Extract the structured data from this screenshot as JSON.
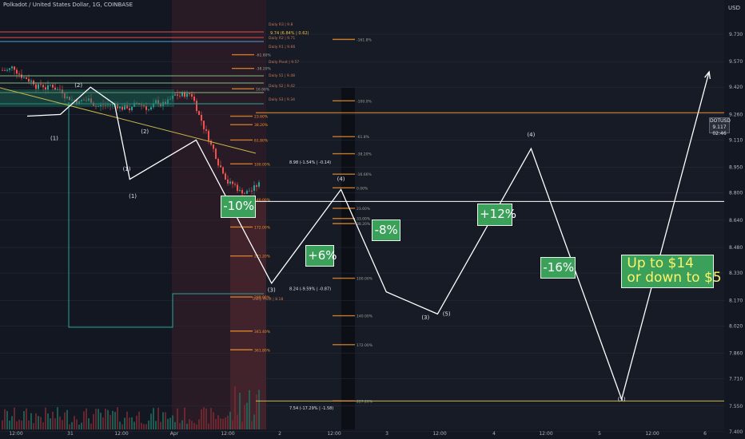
{
  "header": {
    "title": "Polkadot / United States Dollar, 1G, COINBASE",
    "currency": "USD"
  },
  "price_tag": {
    "symbol": "DOTUSD",
    "price": "9.117",
    "timer": "02:46"
  },
  "chart_data": {
    "type": "line",
    "y_axis": {
      "range": [
        7.46,
        9.8
      ],
      "ticks": [
        7.4,
        7.55,
        7.71,
        7.86,
        8.02,
        8.17,
        8.33,
        8.48,
        8.64,
        8.8,
        8.95,
        9.11,
        9.26,
        9.42,
        9.57,
        9.73
      ]
    },
    "x_axis": {
      "labels": [
        "12:00",
        "31",
        "12:00",
        "Apr",
        "12:00",
        "2",
        "12:00",
        "3",
        "12:00",
        "4",
        "12:00",
        "5",
        "12:00",
        "6"
      ]
    },
    "series": [
      {
        "values": [
          [
            9.25,
            7.49
          ],
          [
            9.26,
            7.6
          ],
          [
            9.42,
            7.7
          ],
          [
            9.32,
            7.78
          ],
          [
            8.88,
            7.83
          ],
          [
            9.11,
            8.05
          ],
          [
            8.27,
            8.3
          ],
          [
            8.82,
            8.53
          ],
          [
            8.22,
            8.68
          ],
          [
            8.09,
            8.85
          ],
          [
            9.06,
            9.16
          ],
          [
            7.59,
            9.46
          ],
          [
            9.51,
            9.75
          ]
        ]
      }
    ],
    "wave_labels": [
      {
        "text": "(2)",
        "x": 9.42,
        "y": 7.66
      },
      {
        "text": "(1)",
        "x": 9.11,
        "y": 7.58
      },
      {
        "text": "(1)",
        "x": 8.93,
        "y": 7.82
      },
      {
        "text": "(2)",
        "x": 9.15,
        "y": 7.88
      },
      {
        "text": "(1)",
        "x": 8.77,
        "y": 7.84
      },
      {
        "text": "(3)",
        "x": 8.22,
        "y": 8.3
      },
      {
        "text": "(4)",
        "x": 8.87,
        "y": 8.53
      },
      {
        "text": "(3)",
        "x": 8.06,
        "y": 8.81
      },
      {
        "text": "(5)",
        "x": 8.08,
        "y": 8.88
      },
      {
        "text": "(4)",
        "x": 9.13,
        "y": 9.16
      },
      {
        "text": "(5)",
        "x": 7.58,
        "y": 9.46
      }
    ],
    "callouts": [
      {
        "text": "-10%",
        "x": 8.72,
        "y": 8.19,
        "style": "green"
      },
      {
        "text": "+6%",
        "x": 8.43,
        "y": 8.46,
        "style": "green"
      },
      {
        "text": "-8%",
        "x": 8.58,
        "y": 8.68,
        "style": "green"
      },
      {
        "text": "+12%",
        "x": 8.67,
        "y": 9.04,
        "style": "green"
      },
      {
        "text": "-16%",
        "x": 8.36,
        "y": 9.25,
        "style": "green"
      },
      {
        "text": "Up to $14",
        "x": 8.39,
        "y": 9.47,
        "style": "yellow"
      },
      {
        "text": "or down to $5",
        "x": 8.26,
        "y": 9.47,
        "style": "yellow"
      }
    ],
    "fib_levels": [
      {
        "label": "-161.8%",
        "y": 9.7
      },
      {
        "label": "-100.0%",
        "y": 9.34
      },
      {
        "label": "-61.8%",
        "y": 9.13
      },
      {
        "label": "-38.20%",
        "y": 9.03
      },
      {
        "label": "-16.66%",
        "y": 8.91
      },
      {
        "label": "0.00%",
        "y": 8.83
      },
      {
        "label": "23.60%",
        "y": 8.71
      },
      {
        "label": "33.00%",
        "y": 8.65
      },
      {
        "label": "38.20%",
        "y": 8.62
      },
      {
        "label": "100.00%",
        "y": 8.3
      },
      {
        "label": "140.00%",
        "y": 8.08
      },
      {
        "label": "172.00%",
        "y": 7.91
      },
      {
        "label": "227.20%",
        "y": 7.58
      },
      {
        "label": "23.60%",
        "y": 9.25
      },
      {
        "label": "38.20%",
        "y": 9.2
      },
      {
        "label": "61.80%",
        "y": 9.11
      },
      {
        "label": "100.00%",
        "y": 8.97
      },
      {
        "label": "140.00%",
        "y": 8.76
      },
      {
        "label": "172.00%",
        "y": 8.6
      },
      {
        "label": "221.20%",
        "y": 8.43
      },
      {
        "label": "289.00%",
        "y": 8.19
      },
      {
        "label": "341.40%",
        "y": 7.99
      },
      {
        "label": "361.80%",
        "y": 7.88
      },
      {
        "label": "-61.80%",
        "y": 9.61
      },
      {
        "label": "-38.20%",
        "y": 9.53
      },
      {
        "label": "16.66%",
        "y": 9.41
      }
    ],
    "annotations": [
      {
        "text": "8.98 (-1.54% | -0.14)",
        "y": 8.98
      },
      {
        "text": "8.24 (-9.59% | -0.87)",
        "y": 8.24
      },
      {
        "text": "7.54 (-17.29% | -1.58)",
        "y": 7.54
      },
      {
        "text": "9.74 (6.84% | 0.62)",
        "y": 9.74
      }
    ],
    "daily_labels": [
      {
        "text": "Daily R3 | 9.8",
        "y": 9.79
      },
      {
        "text": "Daily R2 | 9.71",
        "y": 9.71
      },
      {
        "text": "Daily R1 | 9.66",
        "y": 9.66
      },
      {
        "text": "Daily Pivot | 9.57",
        "y": 9.57
      },
      {
        "text": "Daily S1 | 9.48",
        "y": 9.49
      },
      {
        "text": "Daily S2 | 9.42",
        "y": 9.43
      },
      {
        "text": "Daily S3 | 9.34",
        "y": 9.35
      },
      {
        "text": "Daily Pivot | 8.18",
        "y": 8.18
      }
    ],
    "hlines": [
      {
        "y": 8.75,
        "color": "#ffffff"
      },
      {
        "y": 9.27,
        "color": "#f0932b"
      },
      {
        "y": 7.58,
        "color": "#c9b84a"
      }
    ],
    "colors": {
      "background": "#131722",
      "up": "#26a69a",
      "down": "#ef5350",
      "projection": "#ffffff",
      "callout": "#3aa05a",
      "callout_text_alt": "#fff36a"
    }
  }
}
